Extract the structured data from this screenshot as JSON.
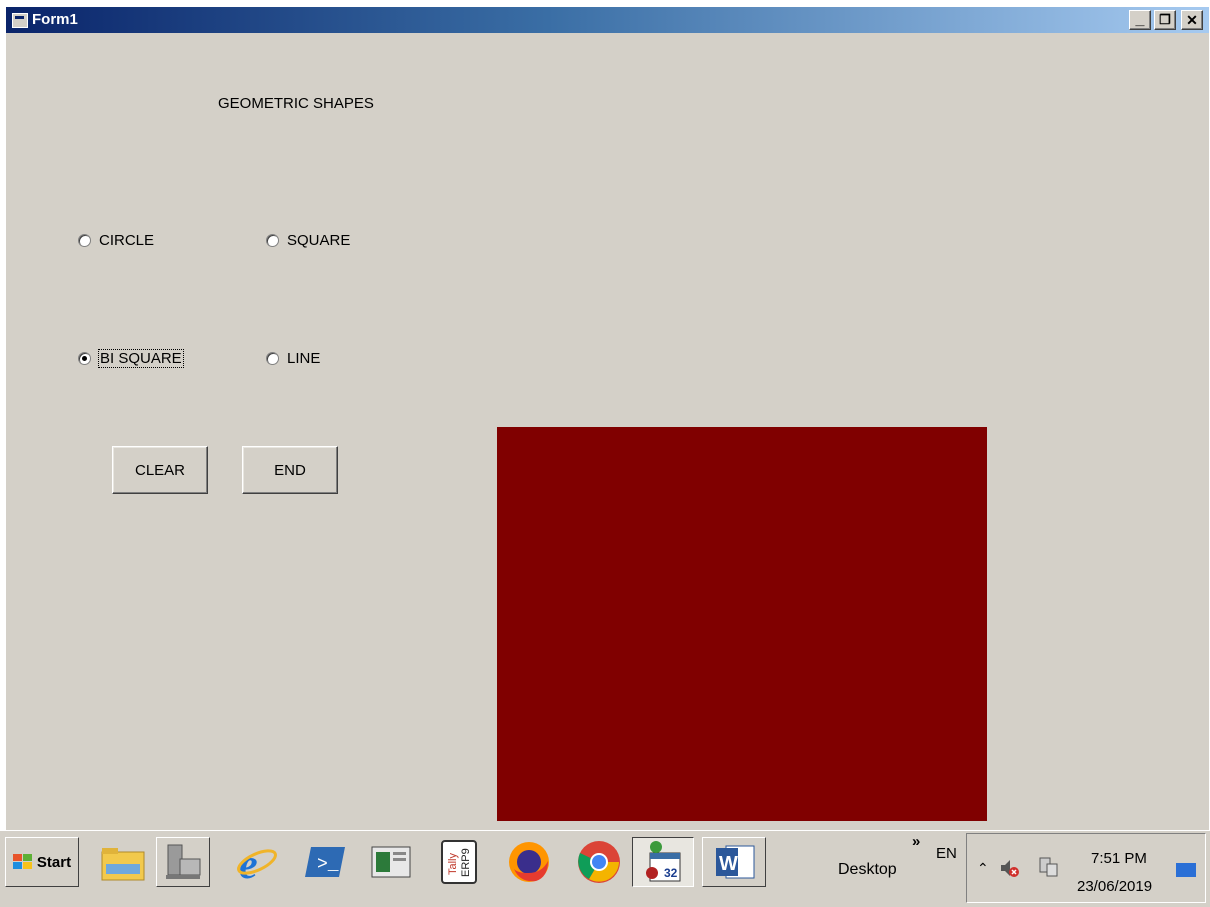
{
  "window": {
    "title": "Form1",
    "minimize": "_",
    "restore": "❐",
    "close": "✕"
  },
  "form": {
    "heading": "GEOMETRIC SHAPES",
    "options": [
      {
        "label": "CIRCLE",
        "checked": false
      },
      {
        "label": "SQUARE",
        "checked": false
      },
      {
        "label": "BI SQUARE",
        "checked": true
      },
      {
        "label": "LINE",
        "checked": false
      }
    ],
    "buttons": {
      "clear": "CLEAR",
      "end": "END"
    },
    "shape_color": "#800000"
  },
  "taskbar": {
    "start_label": "Start",
    "desktop_label": "Desktop",
    "chevron": "»",
    "language": "EN",
    "time": "7:51 PM",
    "date": "23/06/2019",
    "tally_text": "Tally",
    "erp_text": "ERP9",
    "calendar_number": "32",
    "word_letter": "W"
  }
}
